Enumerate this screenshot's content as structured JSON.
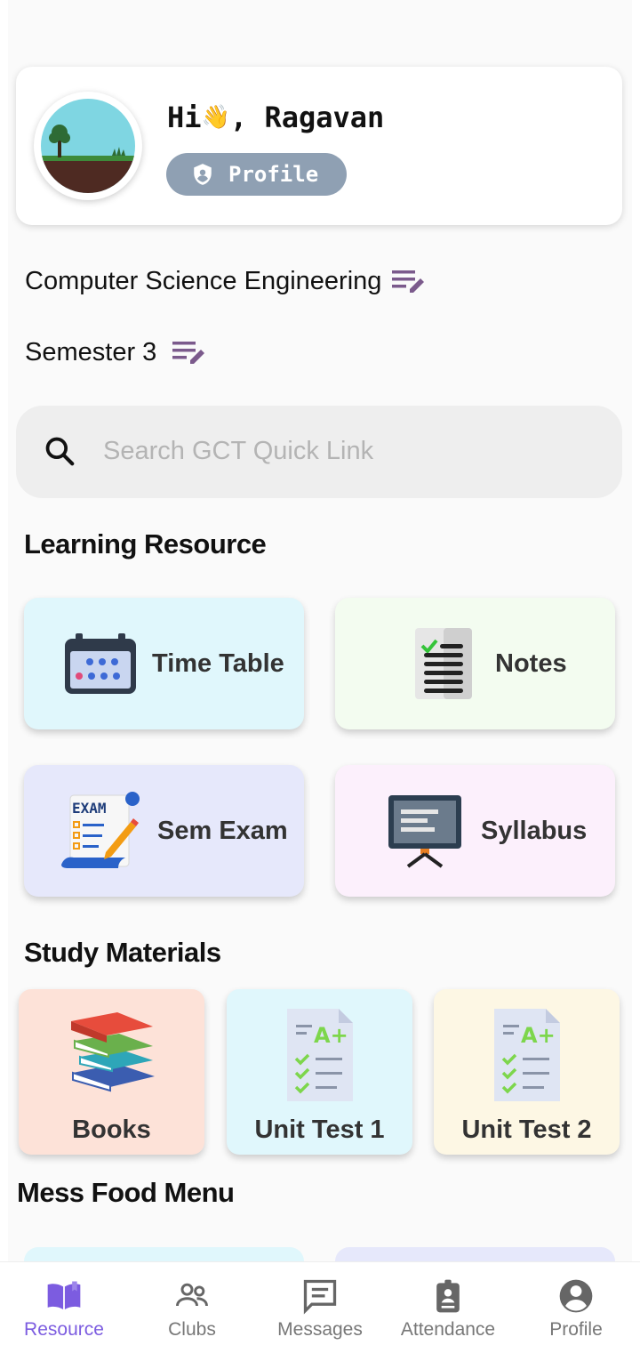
{
  "header": {
    "greeting_prefix": "Hi",
    "greeting_emoji": "👋",
    "greeting_suffix": ", Ragavan",
    "profile_label": "Profile"
  },
  "info": {
    "department": "Computer Science Engineering",
    "semester": "Semester 3"
  },
  "search": {
    "placeholder": "Search GCT Quick Link",
    "value": ""
  },
  "learning": {
    "title": "Learning Resource",
    "items": [
      {
        "label": "Time Table"
      },
      {
        "label": "Notes"
      },
      {
        "label": "Sem Exam"
      },
      {
        "label": "Syllabus"
      }
    ]
  },
  "study": {
    "title": "Study Materials",
    "items": [
      {
        "label": "Books"
      },
      {
        "label": "Unit Test 1"
      },
      {
        "label": "Unit Test 2"
      }
    ]
  },
  "mess": {
    "title": "Mess Food Menu"
  },
  "nav": {
    "items": [
      {
        "label": "Resource",
        "icon": "book-open-icon",
        "active": true
      },
      {
        "label": "Clubs",
        "icon": "people-icon"
      },
      {
        "label": "Messages",
        "icon": "message-icon"
      },
      {
        "label": "Attendance",
        "icon": "badge-icon"
      },
      {
        "label": "Profile",
        "icon": "account-icon"
      }
    ]
  },
  "colors": {
    "accent": "#7c5ce0",
    "edit_icon": "#7b5a8c",
    "pill": "#8fa0b3"
  }
}
